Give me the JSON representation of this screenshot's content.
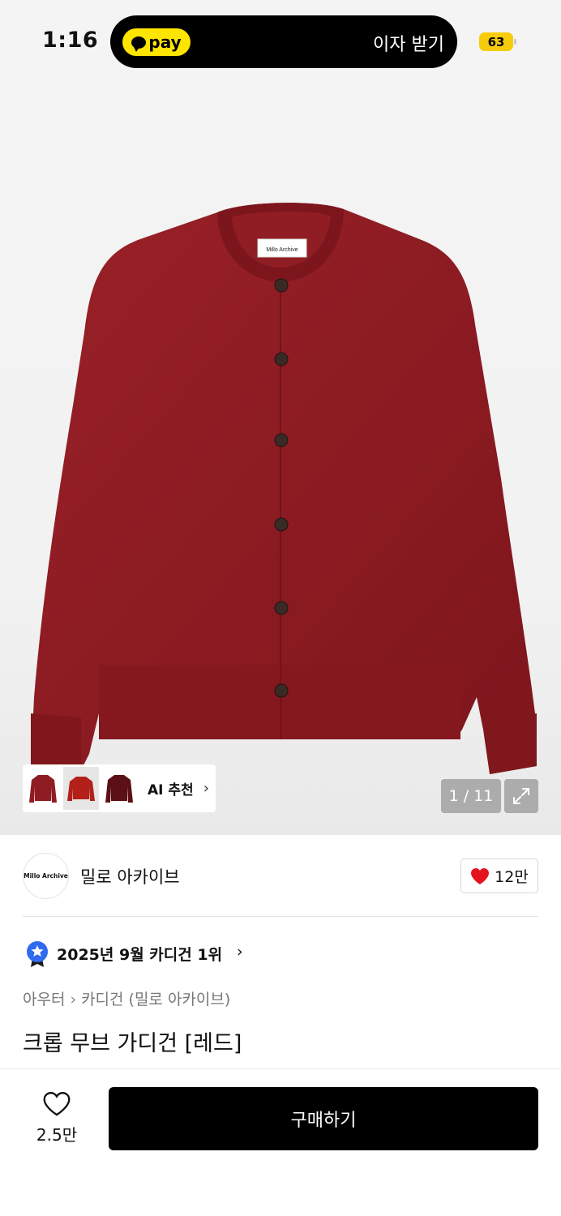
{
  "status_bar": {
    "time": "1:16",
    "battery": "63"
  },
  "pay_banner": {
    "brand": "pay",
    "cta": "이자 받기"
  },
  "product_image": {
    "tag_text": "Millo Archive",
    "counter": "1 / 11",
    "ai_label": "AI 추천"
  },
  "seller": {
    "logo_text": "Millo Archive",
    "name": "밀로 아카이브",
    "likes": "12만"
  },
  "ranking": {
    "text": "2025년 9월 카디건 1위"
  },
  "breadcrumb": {
    "category": "아우터",
    "subcategory": "카디건 (밀로 아카이브)"
  },
  "product": {
    "title": "크롭 무브 가디건 [레드]"
  },
  "bottom_bar": {
    "wish_count": "2.5만",
    "buy_label": "구매하기"
  },
  "colors": {
    "accent": "#000000",
    "pay_yellow": "#FEE500",
    "cardigan": "#8E1C22",
    "heart": "#E5141C",
    "rank_badge": "#2F6BF0"
  }
}
